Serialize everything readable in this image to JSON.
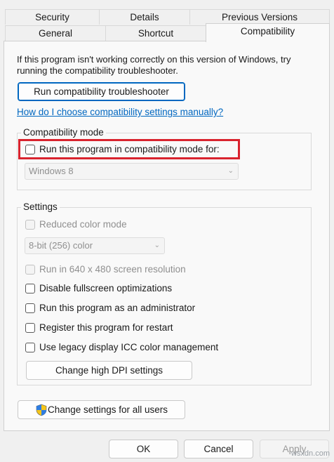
{
  "tabs": {
    "row1": [
      "Security",
      "Details",
      "Previous Versions"
    ],
    "row2": [
      "General",
      "Shortcut",
      "Compatibility"
    ]
  },
  "intro_text_line1": "If this program isn't working correctly on this version of Windows, try",
  "intro_text_line2": "running the compatibility troubleshooter.",
  "run_troubleshooter_label": "Run compatibility troubleshooter",
  "help_link": "How do I choose compatibility settings manually?",
  "compat_mode": {
    "legend": "Compatibility mode",
    "checkbox_label": "Run this program in compatibility mode for:",
    "checked": false,
    "os_selected": "Windows 8"
  },
  "settings": {
    "legend": "Settings",
    "reduced_color_label": "Reduced color mode",
    "color_depth_selected": "8-bit (256) color",
    "resolution_label": "Run in 640 x 480 screen resolution",
    "fullscreen_label": "Disable fullscreen optimizations",
    "admin_label": "Run this program as an administrator",
    "restart_label": "Register this program for restart",
    "icc_label": "Use legacy display ICC color management",
    "high_dpi_label": "Change high DPI settings"
  },
  "change_all_users_label": "Change settings for all users",
  "footer": {
    "ok": "OK",
    "cancel": "Cancel",
    "apply": "Apply"
  },
  "watermark": "wsxdn.com",
  "colors": {
    "accent": "#0067c0",
    "highlight": "#d9232e"
  }
}
